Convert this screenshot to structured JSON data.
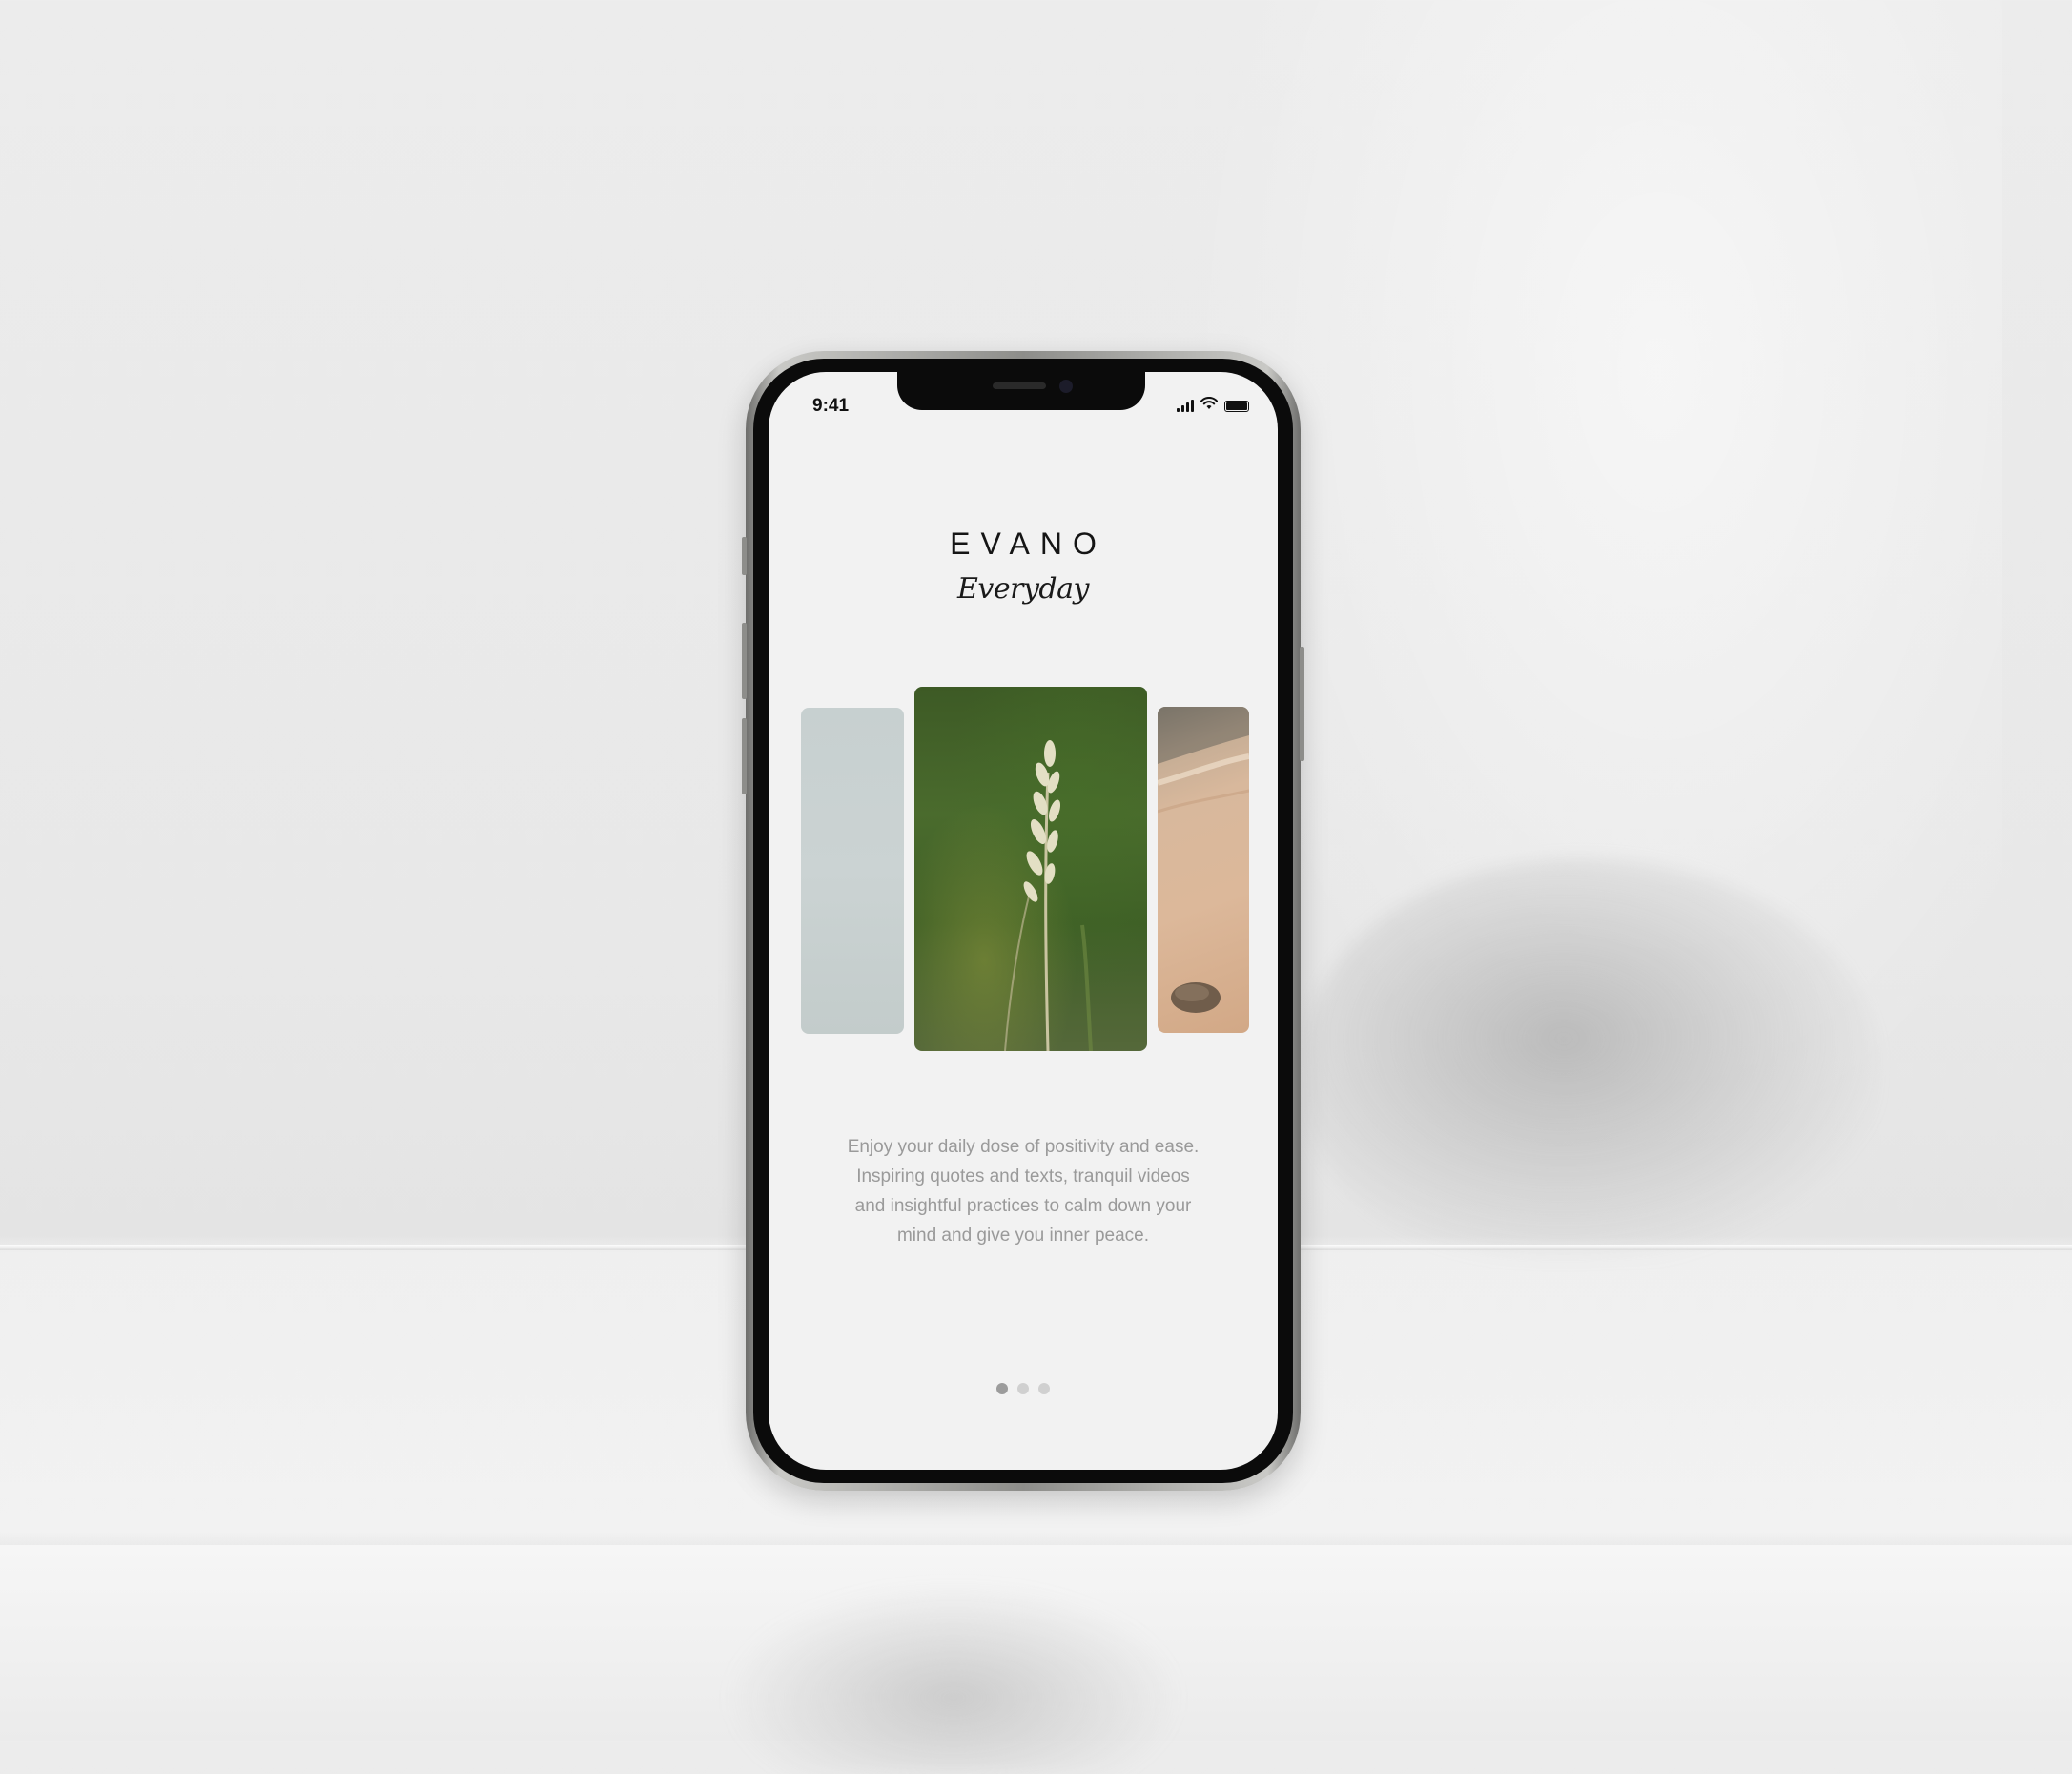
{
  "status_bar": {
    "time": "9:41"
  },
  "app": {
    "logo": "EVANO",
    "tagline": "Everyday",
    "description": "Enjoy your daily dose of positivity and ease. Inspiring quotes and texts, tranquil videos and insightful practices to calm down your mind and give you inner peace."
  },
  "carousel": {
    "cards": [
      {
        "name": "pale-sky"
      },
      {
        "name": "grass-stem"
      },
      {
        "name": "sand-beach"
      }
    ],
    "page_count": 3,
    "active_page": 1
  },
  "colors": {
    "screen_bg": "#f2f2f2",
    "text_dark": "#151515",
    "text_muted": "#9a9a9a",
    "dot_active": "#9c9c9c",
    "dot_inactive": "#d0d0d0"
  },
  "icons": [
    "cellular-signal-icon",
    "wifi-icon",
    "battery-icon"
  ]
}
